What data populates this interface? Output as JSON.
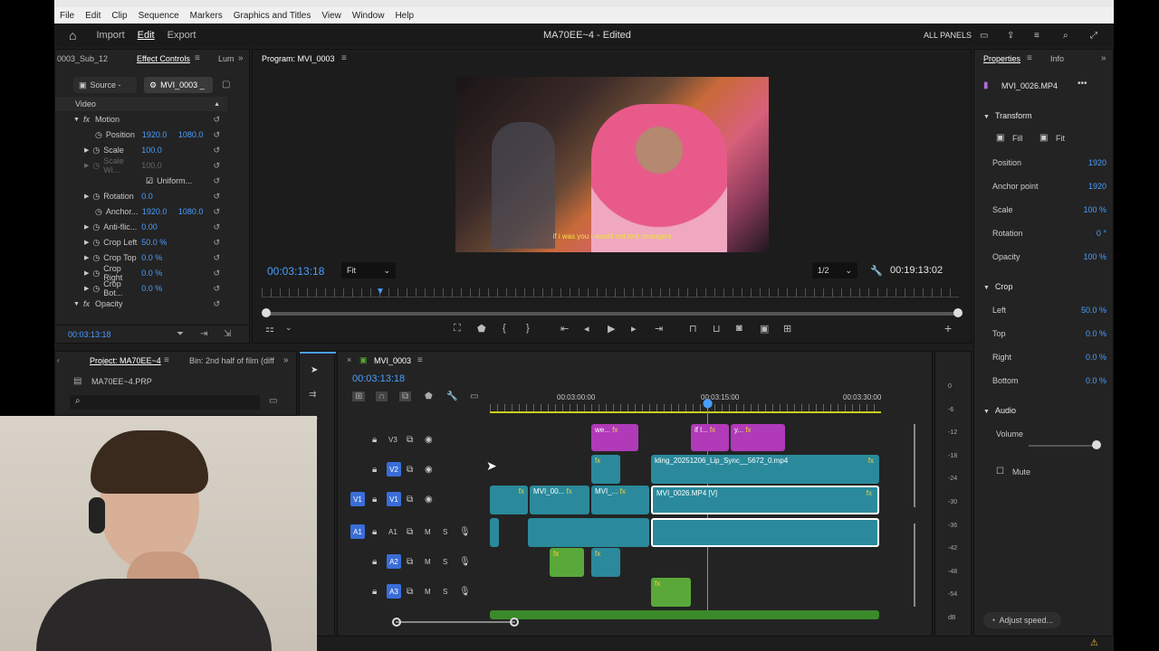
{
  "menu": [
    "File",
    "Edit",
    "Clip",
    "Sequence",
    "Markers",
    "Graphics and Titles",
    "View",
    "Window",
    "Help"
  ],
  "header": {
    "tabs": [
      "Import",
      "Edit",
      "Export"
    ],
    "doc_title": "MA70EE~4 - Edited",
    "all_panels": "ALL PANELS"
  },
  "effect_controls": {
    "tabs": [
      "0003_Sub_12",
      "Effect Controls",
      "Lum"
    ],
    "source_tab": "Source -",
    "clip_tab": "MVI_0003 _",
    "section": "Video",
    "motion": "Motion",
    "rows": [
      {
        "name": "Position",
        "v1": "1920.0",
        "v2": "1080.0"
      },
      {
        "name": "Scale",
        "v1": "100.0",
        "v2": ""
      },
      {
        "name": "Scale Wi...",
        "v1": "100.0",
        "v2": ""
      },
      {
        "name": "Uniform...",
        "v1": "",
        "v2": ""
      },
      {
        "name": "Rotation",
        "v1": "0.0",
        "v2": ""
      },
      {
        "name": "Anchor...",
        "v1": "1920.0",
        "v2": "1080.0"
      },
      {
        "name": "Anti-flic...",
        "v1": "0.00",
        "v2": ""
      },
      {
        "name": "Crop Left",
        "v1": "50.0 %",
        "v2": ""
      },
      {
        "name": "Crop Top",
        "v1": "0.0 %",
        "v2": ""
      },
      {
        "name": "Crop Right",
        "v1": "0.0 %",
        "v2": ""
      },
      {
        "name": "Crop Bot...",
        "v1": "0.0 %",
        "v2": ""
      }
    ],
    "opacity": "Opacity",
    "timecode": "00:03:13:18"
  },
  "program": {
    "title": "Program: MVI_0003",
    "subtitle": "if i was you i would not text strangers",
    "timecode": "00:03:13:18",
    "fit": "Fit",
    "resolution": "1/2",
    "duration": "00:19:13:02"
  },
  "properties": {
    "tabs": [
      "Properties",
      "Info"
    ],
    "clip": "MVI_0026.MP4",
    "transform": "Transform",
    "fill": "Fill",
    "fit": "Fit",
    "rows": [
      {
        "name": "Position",
        "val": "1920"
      },
      {
        "name": "Anchor point",
        "val": "1920"
      },
      {
        "name": "Scale",
        "val": "100 %"
      },
      {
        "name": "Rotation",
        "val": "0 °"
      },
      {
        "name": "Opacity",
        "val": "100 %"
      }
    ],
    "crop": "Crop",
    "crop_rows": [
      {
        "name": "Left",
        "val": "50.0 %"
      },
      {
        "name": "Top",
        "val": "0.0 %"
      },
      {
        "name": "Right",
        "val": "0.0 %"
      },
      {
        "name": "Bottom",
        "val": "0.0 %"
      }
    ],
    "audio": "Audio",
    "volume": "Volume",
    "mute": "Mute",
    "adjust_speed": "Adjust speed..."
  },
  "project": {
    "tabs": [
      "Project: MA70EE~4",
      "Bin: 2nd half of film (diff"
    ],
    "file": "MA70EE~4.PRP"
  },
  "timeline": {
    "tab": "MVI_0003",
    "timecode": "00:03:13:18",
    "ruler": [
      "00:03:00:00",
      "00:03:15:00",
      "00:03:30:00"
    ],
    "tracks": [
      "V3",
      "V2",
      "V1",
      "A1",
      "A2",
      "A3"
    ],
    "clips": {
      "v3a": "we...",
      "v3b": "if l...",
      "v3c": "y...",
      "v2": "kling_20251206_Lip_Sync__5672_0.mp4",
      "v1a": "MVI_00...",
      "v1b": "MVI_...",
      "v1c": "MVI_0026.MP4 [V]"
    }
  },
  "meter": {
    "labels": [
      "0",
      "-6",
      "-12",
      "-18",
      "-24",
      "-30",
      "-36",
      "-42",
      "-48",
      "-54",
      "dB"
    ]
  },
  "colors": {
    "accent": "#4a9eff",
    "clip_blue": "#2a8a9c",
    "clip_pink": "#b03ab8",
    "clip_green": "#5aa83a",
    "track_blue": "#3a6dd8"
  }
}
